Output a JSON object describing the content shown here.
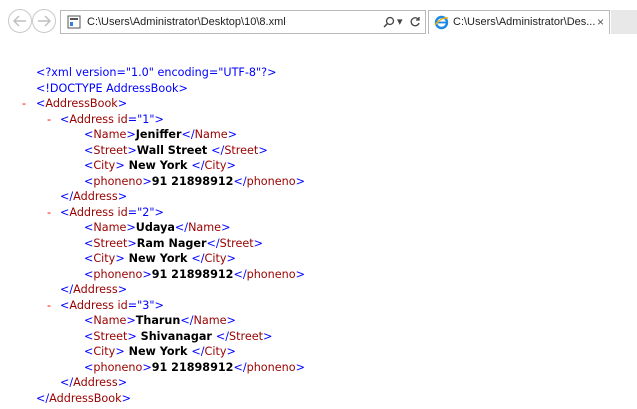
{
  "browser": {
    "address": "C:\\Users\\Administrator\\Desktop\\10\\8.xml",
    "search_icon": "search-icon",
    "refresh_icon": "refresh-icon",
    "tab_title": "C:\\Users\\Administrator\\Des...",
    "tab_close": "×",
    "dropdown": "▾"
  },
  "xml": {
    "minus": "-",
    "lt": "<",
    "gt": ">",
    "close_lt": "</",
    "decl": "<?xml version=\"1.0\" encoding=\"UTF-8\"?>",
    "doctype": "<!DOCTYPE AddressBook>",
    "tag_addressbook": "AddressBook",
    "tag_address": "Address",
    "attr_id": "id",
    "eq": "=",
    "tag_name": "Name",
    "tag_street": "Street",
    "tag_city": "City",
    "tag_phone": "phoneno",
    "addresses": [
      {
        "id": "\"1\"",
        "name": "Jeniffer",
        "street": "Wall Street ",
        "city": " New York ",
        "phone": "91 21898912"
      },
      {
        "id": "\"2\"",
        "name": "Udaya",
        "street": "Ram Nager",
        "city": " New York ",
        "phone": "91 21898912"
      },
      {
        "id": "\"3\"",
        "name": "Tharun",
        "street": " Shivanagar ",
        "city": " New York ",
        "phone": "91 21898912"
      }
    ]
  }
}
